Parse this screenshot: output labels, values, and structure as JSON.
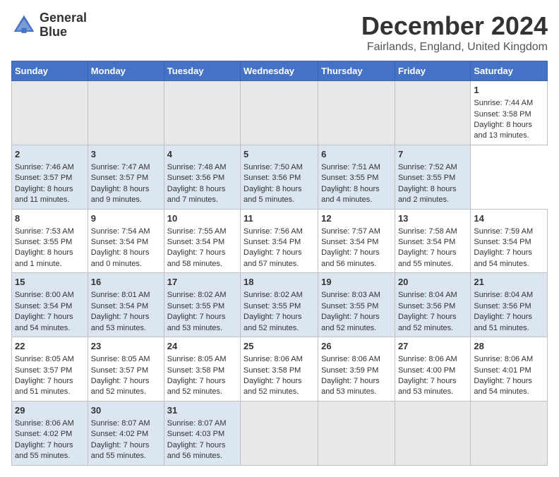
{
  "header": {
    "logo_line1": "General",
    "logo_line2": "Blue",
    "main_title": "December 2024",
    "subtitle": "Fairlands, England, United Kingdom"
  },
  "calendar": {
    "days_of_week": [
      "Sunday",
      "Monday",
      "Tuesday",
      "Wednesday",
      "Thursday",
      "Friday",
      "Saturday"
    ],
    "weeks": [
      [
        null,
        null,
        null,
        null,
        null,
        null,
        {
          "day": "1",
          "sunrise": "Sunrise: 7:44 AM",
          "sunset": "Sunset: 3:58 PM",
          "daylight": "Daylight: 8 hours and 13 minutes."
        }
      ],
      [
        {
          "day": "2",
          "sunrise": "Sunrise: 7:46 AM",
          "sunset": "Sunset: 3:57 PM",
          "daylight": "Daylight: 8 hours and 11 minutes."
        },
        {
          "day": "3",
          "sunrise": "Sunrise: 7:47 AM",
          "sunset": "Sunset: 3:57 PM",
          "daylight": "Daylight: 8 hours and 9 minutes."
        },
        {
          "day": "4",
          "sunrise": "Sunrise: 7:48 AM",
          "sunset": "Sunset: 3:56 PM",
          "daylight": "Daylight: 8 hours and 7 minutes."
        },
        {
          "day": "5",
          "sunrise": "Sunrise: 7:50 AM",
          "sunset": "Sunset: 3:56 PM",
          "daylight": "Daylight: 8 hours and 5 minutes."
        },
        {
          "day": "6",
          "sunrise": "Sunrise: 7:51 AM",
          "sunset": "Sunset: 3:55 PM",
          "daylight": "Daylight: 8 hours and 4 minutes."
        },
        {
          "day": "7",
          "sunrise": "Sunrise: 7:52 AM",
          "sunset": "Sunset: 3:55 PM",
          "daylight": "Daylight: 8 hours and 2 minutes."
        }
      ],
      [
        {
          "day": "8",
          "sunrise": "Sunrise: 7:53 AM",
          "sunset": "Sunset: 3:55 PM",
          "daylight": "Daylight: 8 hours and 1 minute."
        },
        {
          "day": "9",
          "sunrise": "Sunrise: 7:54 AM",
          "sunset": "Sunset: 3:54 PM",
          "daylight": "Daylight: 8 hours and 0 minutes."
        },
        {
          "day": "10",
          "sunrise": "Sunrise: 7:55 AM",
          "sunset": "Sunset: 3:54 PM",
          "daylight": "Daylight: 7 hours and 58 minutes."
        },
        {
          "day": "11",
          "sunrise": "Sunrise: 7:56 AM",
          "sunset": "Sunset: 3:54 PM",
          "daylight": "Daylight: 7 hours and 57 minutes."
        },
        {
          "day": "12",
          "sunrise": "Sunrise: 7:57 AM",
          "sunset": "Sunset: 3:54 PM",
          "daylight": "Daylight: 7 hours and 56 minutes."
        },
        {
          "day": "13",
          "sunrise": "Sunrise: 7:58 AM",
          "sunset": "Sunset: 3:54 PM",
          "daylight": "Daylight: 7 hours and 55 minutes."
        },
        {
          "day": "14",
          "sunrise": "Sunrise: 7:59 AM",
          "sunset": "Sunset: 3:54 PM",
          "daylight": "Daylight: 7 hours and 54 minutes."
        }
      ],
      [
        {
          "day": "15",
          "sunrise": "Sunrise: 8:00 AM",
          "sunset": "Sunset: 3:54 PM",
          "daylight": "Daylight: 7 hours and 54 minutes."
        },
        {
          "day": "16",
          "sunrise": "Sunrise: 8:01 AM",
          "sunset": "Sunset: 3:54 PM",
          "daylight": "Daylight: 7 hours and 53 minutes."
        },
        {
          "day": "17",
          "sunrise": "Sunrise: 8:02 AM",
          "sunset": "Sunset: 3:55 PM",
          "daylight": "Daylight: 7 hours and 53 minutes."
        },
        {
          "day": "18",
          "sunrise": "Sunrise: 8:02 AM",
          "sunset": "Sunset: 3:55 PM",
          "daylight": "Daylight: 7 hours and 52 minutes."
        },
        {
          "day": "19",
          "sunrise": "Sunrise: 8:03 AM",
          "sunset": "Sunset: 3:55 PM",
          "daylight": "Daylight: 7 hours and 52 minutes."
        },
        {
          "day": "20",
          "sunrise": "Sunrise: 8:04 AM",
          "sunset": "Sunset: 3:56 PM",
          "daylight": "Daylight: 7 hours and 52 minutes."
        },
        {
          "day": "21",
          "sunrise": "Sunrise: 8:04 AM",
          "sunset": "Sunset: 3:56 PM",
          "daylight": "Daylight: 7 hours and 51 minutes."
        }
      ],
      [
        {
          "day": "22",
          "sunrise": "Sunrise: 8:05 AM",
          "sunset": "Sunset: 3:57 PM",
          "daylight": "Daylight: 7 hours and 51 minutes."
        },
        {
          "day": "23",
          "sunrise": "Sunrise: 8:05 AM",
          "sunset": "Sunset: 3:57 PM",
          "daylight": "Daylight: 7 hours and 52 minutes."
        },
        {
          "day": "24",
          "sunrise": "Sunrise: 8:05 AM",
          "sunset": "Sunset: 3:58 PM",
          "daylight": "Daylight: 7 hours and 52 minutes."
        },
        {
          "day": "25",
          "sunrise": "Sunrise: 8:06 AM",
          "sunset": "Sunset: 3:58 PM",
          "daylight": "Daylight: 7 hours and 52 minutes."
        },
        {
          "day": "26",
          "sunrise": "Sunrise: 8:06 AM",
          "sunset": "Sunset: 3:59 PM",
          "daylight": "Daylight: 7 hours and 53 minutes."
        },
        {
          "day": "27",
          "sunrise": "Sunrise: 8:06 AM",
          "sunset": "Sunset: 4:00 PM",
          "daylight": "Daylight: 7 hours and 53 minutes."
        },
        {
          "day": "28",
          "sunrise": "Sunrise: 8:06 AM",
          "sunset": "Sunset: 4:01 PM",
          "daylight": "Daylight: 7 hours and 54 minutes."
        }
      ],
      [
        {
          "day": "29",
          "sunrise": "Sunrise: 8:06 AM",
          "sunset": "Sunset: 4:02 PM",
          "daylight": "Daylight: 7 hours and 55 minutes."
        },
        {
          "day": "30",
          "sunrise": "Sunrise: 8:07 AM",
          "sunset": "Sunset: 4:02 PM",
          "daylight": "Daylight: 7 hours and 55 minutes."
        },
        {
          "day": "31",
          "sunrise": "Sunrise: 8:07 AM",
          "sunset": "Sunset: 4:03 PM",
          "daylight": "Daylight: 7 hours and 56 minutes."
        },
        null,
        null,
        null,
        null
      ]
    ]
  }
}
